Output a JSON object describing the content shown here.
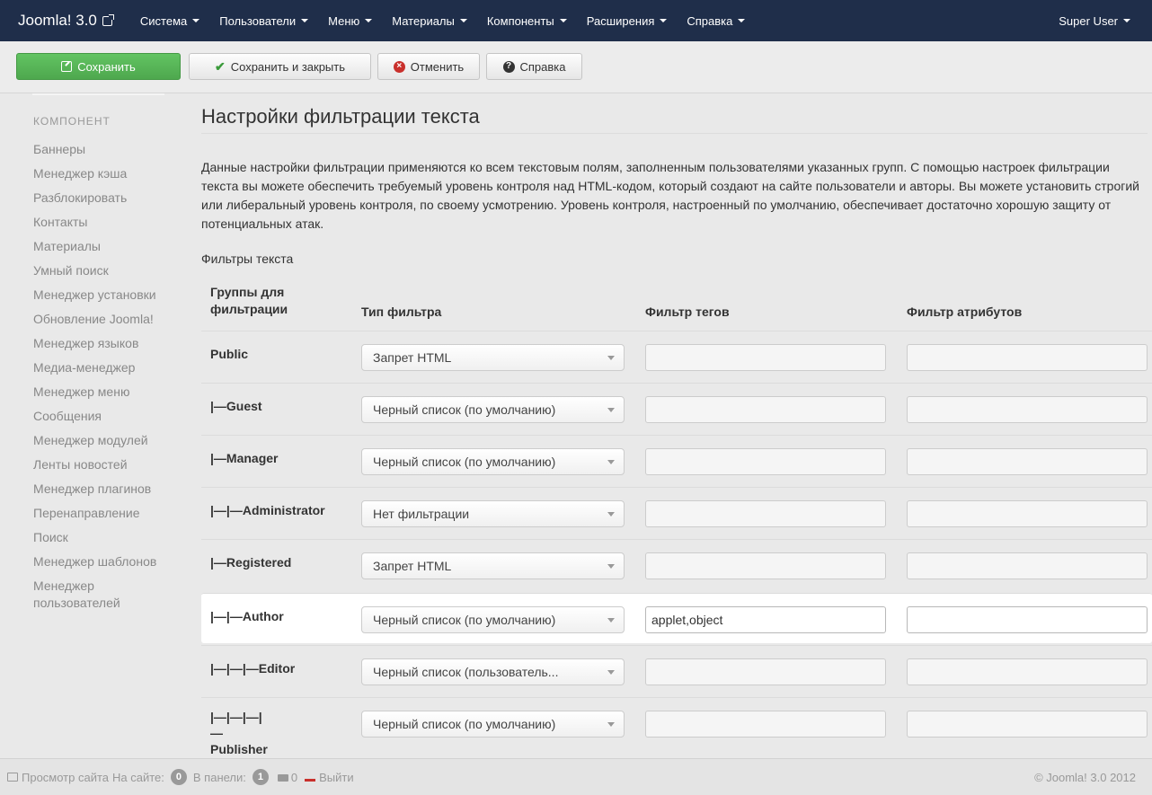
{
  "navbar": {
    "brand": "Joomla! 3.0",
    "menu": [
      "Система",
      "Пользователи",
      "Меню",
      "Материалы",
      "Компоненты",
      "Расширения",
      "Справка"
    ],
    "user": "Super User"
  },
  "toolbar": {
    "save": "Сохранить",
    "save_close": "Сохранить и закрыть",
    "cancel": "Отменить",
    "help": "Справка"
  },
  "sidebar": {
    "heading": "КОМПОНЕНТ",
    "items": [
      "Баннеры",
      "Менеджер кэша",
      "Разблокировать",
      "Контакты",
      "Материалы",
      "Умный поиск",
      "Менеджер установки",
      "Обновление Joomla!",
      "Менеджер языков",
      "Медиа-менеджер",
      "Менеджер меню",
      "Сообщения",
      "Менеджер модулей",
      "Ленты новостей",
      "Менеджер плагинов",
      "Перенаправление",
      "Поиск",
      "Менеджер шаблонов",
      "Менеджер пользователей"
    ]
  },
  "main": {
    "title": "Настройки фильтрации текста",
    "description": "Данные настройки фильтрации применяются ко всем текстовым полям, заполненным пользователями указанных групп. С помощью настроек фильтрации текста вы можете обеспечить требуемый уровень контроля над HTML-кодом, который создают на сайте пользователи и авторы. Вы можете установить строгий или либеральный уровень контроля, по своему усмотрению. Уровень контроля, настроенный по умолчанию, обеспечивает достаточно хорошую защиту от потенциальных атак.",
    "filters_label": "Фильтры текста",
    "columns": [
      "Группы для фильтрации",
      "Тип фильтра",
      "Фильтр тегов",
      "Фильтр атрибутов"
    ],
    "rows": [
      {
        "group": "Public",
        "filter": "Запрет HTML",
        "tags": "",
        "attrs": ""
      },
      {
        "group": "|—Guest",
        "filter": "Черный список (по умолчанию)",
        "tags": "",
        "attrs": ""
      },
      {
        "group": "|—Manager",
        "filter": "Черный список (по умолчанию)",
        "tags": "",
        "attrs": ""
      },
      {
        "group": "|—|—Administrator",
        "filter": "Нет фильтрации",
        "tags": "",
        "attrs": ""
      },
      {
        "group": "|—Registered",
        "filter": "Запрет HTML",
        "tags": "",
        "attrs": ""
      },
      {
        "group": "|—|—Author",
        "filter": "Черный список (по умолчанию)",
        "tags": "applet,object",
        "attrs": ""
      },
      {
        "group": "|—|—|—Editor",
        "filter": "Черный список (пользователь...",
        "tags": "",
        "attrs": ""
      },
      {
        "group": "|—|—|—|—Publisher",
        "filter": "Черный список (по умолчанию)",
        "tags": "",
        "attrs": ""
      }
    ]
  },
  "footer": {
    "view_site": "Просмотр сайта",
    "on_site_label": "На сайте:",
    "on_site_count": "0",
    "in_panel_label": "В панели:",
    "in_panel_count": "1",
    "messages_count": "0",
    "logout": "Выйти",
    "copyright": "© Joomla! 3.0 2012"
  }
}
